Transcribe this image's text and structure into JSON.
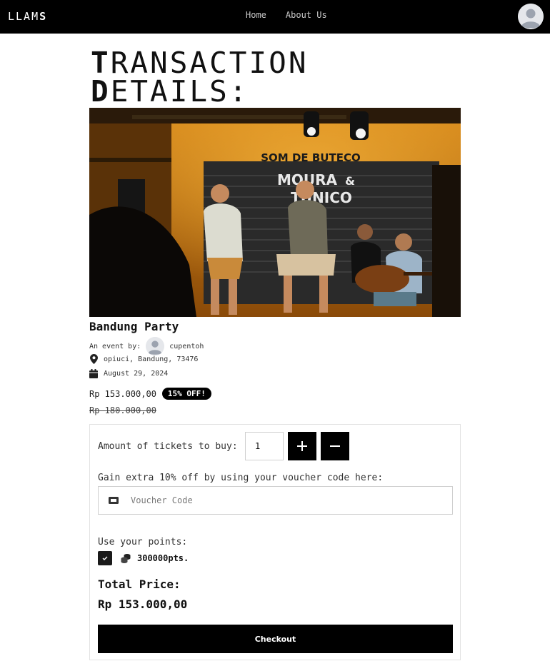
{
  "navbar": {
    "logo_thin": "LLAM",
    "logo_bold": "S",
    "links": [
      {
        "label": "Home"
      },
      {
        "label": "About Us"
      }
    ],
    "profile_icon": "user-avatar-icon"
  },
  "page": {
    "title_line1_cap": "T",
    "title_line1_rest": "RANSACTION",
    "title_line2_cap": "D",
    "title_line2_rest": "ETAILS:"
  },
  "hero": {
    "banner_top_text": "SOM DE BUTECO",
    "banner_main_text_1": "MOURA",
    "banner_main_text_2": "&",
    "banner_main_text_3": "TUNICO"
  },
  "event": {
    "title": "Bandung Party",
    "organizer_prefix": "An event by:",
    "organizer_name": "cupentoh",
    "location": "opiuci, Bandung, 73476",
    "date": "August 29, 2024",
    "price": "Rp 153.000,00",
    "discount_badge": "15% OFF!",
    "original_price": "Rp 180.000,00"
  },
  "purchase": {
    "amount_label": "Amount of tickets to buy:",
    "quantity": "1",
    "voucher_label": "Gain extra 10% off by using your voucher code here:",
    "voucher_placeholder": "Voucher Code",
    "points_label": "Use your points:",
    "points_checked": true,
    "points_value": "300000pts.",
    "total_label": "Total Price:",
    "total_value": "Rp 153.000,00",
    "checkout_label": "Checkout"
  },
  "colors": {
    "navbar_bg": "#000000",
    "accent": "#000000",
    "page_bg": "#ffffff"
  }
}
